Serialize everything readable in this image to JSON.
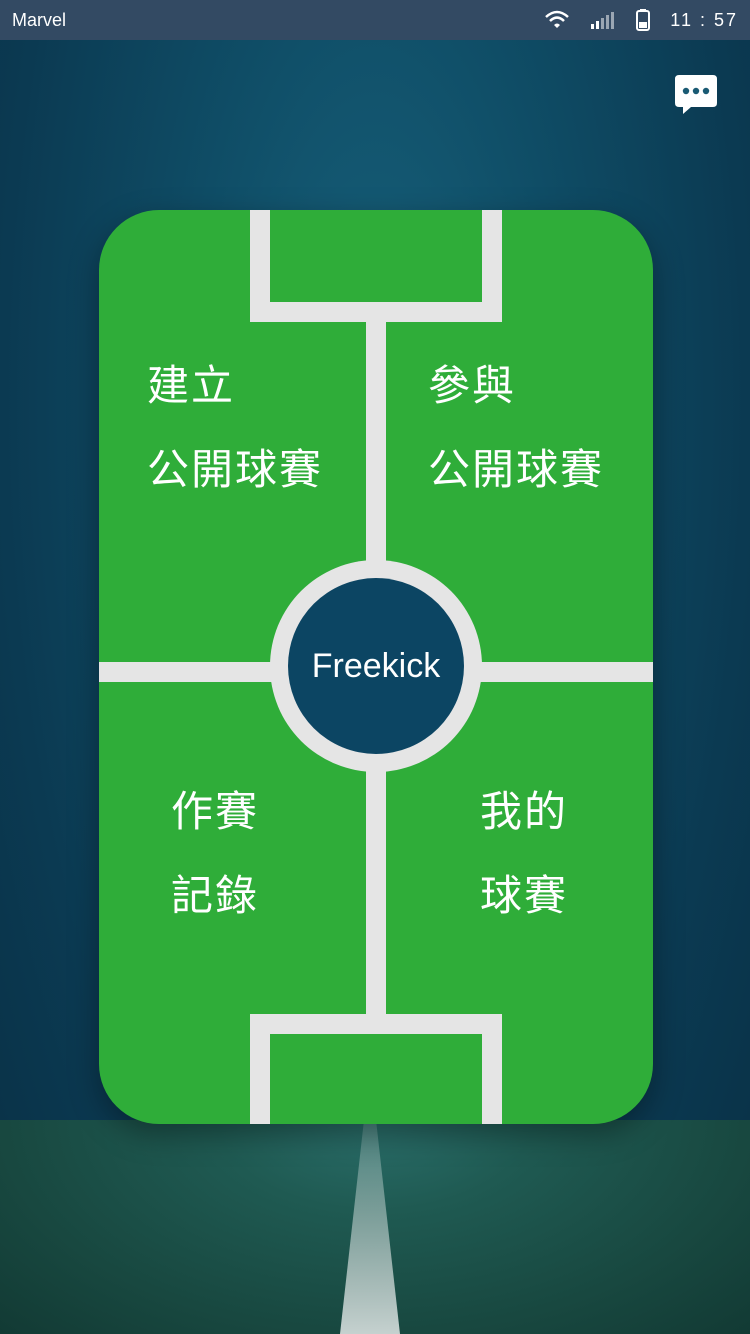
{
  "status_bar": {
    "carrier": "Marvel",
    "time": "11 : 57",
    "icons": [
      "wifi-icon",
      "signal-icon",
      "battery-icon"
    ]
  },
  "header": {
    "chat_icon": "chat-bubble-icon"
  },
  "menu": {
    "create_line1": "建立",
    "create_line2": "公開球賽",
    "join_line1": "參與",
    "join_line2": "公開球賽",
    "records_line1": "作賽",
    "records_line2": "記錄",
    "mine_line1": "我的",
    "mine_line2": "球賽"
  },
  "center": {
    "logo_text": "Freekick"
  },
  "colors": {
    "field_green": "#2fad39",
    "center_blue": "#0c4563",
    "status_bar": "#334a63"
  }
}
